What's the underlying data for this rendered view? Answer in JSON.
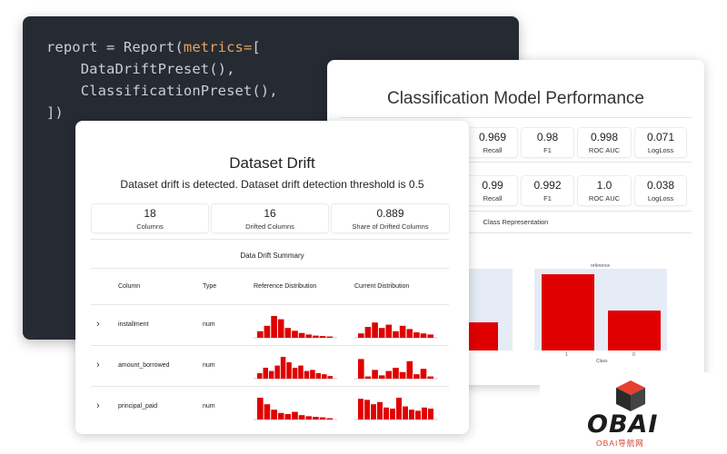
{
  "code": {
    "line1_a": "report = Report(",
    "line1_kw": "metrics=",
    "line1_b": "[",
    "line2": "    DataDriftPreset(),",
    "line3": "    ClassificationPreset(),",
    "line4": "])"
  },
  "classification": {
    "title": "Classification Model Performance",
    "row1": [
      {
        "value": "0.969",
        "label": "Recall"
      },
      {
        "value": "0.98",
        "label": "F1"
      },
      {
        "value": "0.998",
        "label": "ROC AUC"
      },
      {
        "value": "0.071",
        "label": "LogLoss"
      }
    ],
    "row2": [
      {
        "value": "0.99",
        "label": "Recall"
      },
      {
        "value": "0.992",
        "label": "F1"
      },
      {
        "value": "1.0",
        "label": "ROC AUC"
      },
      {
        "value": "0.038",
        "label": "LogLoss"
      }
    ],
    "class_representation_title": "Class Representation",
    "reference_chart_title": "reference",
    "reference_xlabel": "Class",
    "accent_color": "#e00000",
    "plot_bg_color": "#e5ecf6"
  },
  "drift": {
    "title": "Dataset Drift",
    "subtitle": "Dataset drift is detected. Dataset drift detection threshold is 0.5",
    "counters": [
      {
        "value": "18",
        "label": "Columns"
      },
      {
        "value": "16",
        "label": "Drifted Columns"
      },
      {
        "value": "0.889",
        "label": "Share of Drifted Columns"
      }
    ],
    "summary_title": "Data Drift Summary",
    "headers": {
      "column": "Column",
      "type": "Type",
      "reference": "Reference Distribution",
      "current": "Current Distribution"
    },
    "rows": [
      {
        "name": "installment",
        "type": "num"
      },
      {
        "name": "amount_borrowed",
        "type": "num"
      },
      {
        "name": "principal_paid",
        "type": "num"
      }
    ]
  },
  "chart_data": [
    {
      "type": "bar",
      "title": "reference",
      "xlabel": "Class",
      "ylabel": "",
      "categories": [
        "1",
        "0"
      ],
      "values": [
        1.0,
        0.52
      ]
    },
    {
      "type": "bar",
      "title": "installment reference distribution",
      "values": [
        0.3,
        0.55,
        1.0,
        0.85,
        0.45,
        0.32,
        0.22,
        0.15,
        0.1,
        0.08,
        0.06
      ]
    },
    {
      "type": "bar",
      "title": "installment current distribution",
      "values": [
        0.2,
        0.5,
        0.7,
        0.45,
        0.6,
        0.3,
        0.55,
        0.4,
        0.25,
        0.2,
        0.15
      ]
    },
    {
      "type": "bar",
      "title": "amount_borrowed reference distribution",
      "values": [
        0.25,
        0.5,
        0.35,
        0.6,
        1.0,
        0.75,
        0.5,
        0.6,
        0.35,
        0.4,
        0.25,
        0.2,
        0.12
      ]
    },
    {
      "type": "bar",
      "title": "amount_borrowed current distribution",
      "values": [
        0.9,
        0.1,
        0.4,
        0.15,
        0.35,
        0.5,
        0.3,
        0.8,
        0.2,
        0.45,
        0.1
      ]
    },
    {
      "type": "bar",
      "title": "principal_paid reference distribution",
      "values": [
        1.0,
        0.7,
        0.45,
        0.3,
        0.25,
        0.35,
        0.2,
        0.15,
        0.12,
        0.1,
        0.06
      ]
    },
    {
      "type": "bar",
      "title": "principal_paid current distribution",
      "values": [
        0.95,
        0.9,
        0.7,
        0.8,
        0.55,
        0.5,
        1.0,
        0.6,
        0.45,
        0.4,
        0.55,
        0.5
      ]
    }
  ],
  "watermark": {
    "text": "OBAI",
    "sub": "OBAI导航网"
  }
}
